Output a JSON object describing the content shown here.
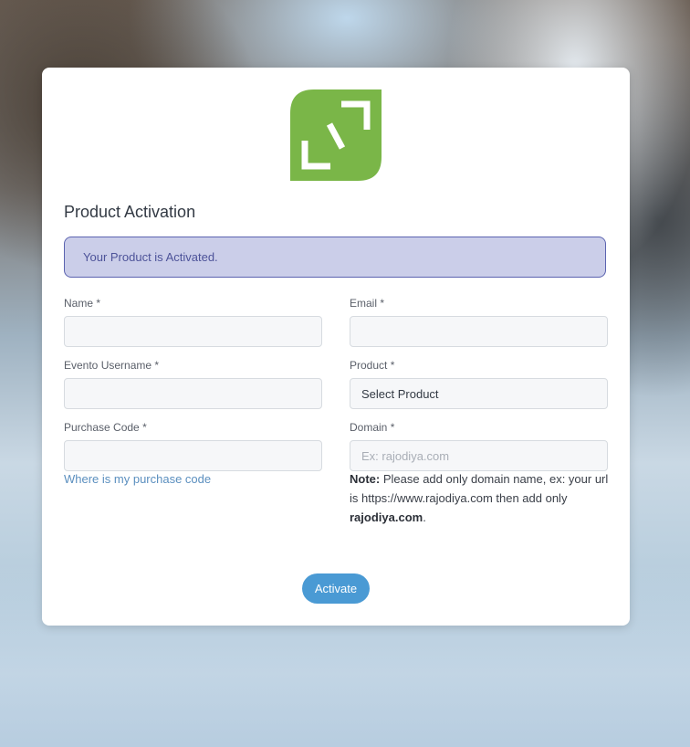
{
  "page": {
    "title": "Product Activation",
    "alert": "Your Product is Activated."
  },
  "form": {
    "name": {
      "label": "Name",
      "required": "*",
      "value": ""
    },
    "email": {
      "label": "Email",
      "required": "*",
      "value": ""
    },
    "username": {
      "label": "Evento Username",
      "required": "*",
      "value": ""
    },
    "product": {
      "label": "Product",
      "required": "*",
      "selected": "Select Product"
    },
    "purchase_code": {
      "label": "Purchase Code",
      "required": "*",
      "value": ""
    },
    "domain": {
      "label": "Domain",
      "required": "*",
      "placeholder": "Ex: rajodiya.com",
      "value": ""
    },
    "purchase_code_link": "Where is my purchase code",
    "note": {
      "prefix": "Note:",
      "text": "Please add only domain name, ex: your url is https://www.rajodiya.com then add only",
      "example": "rajodiya.com",
      "suffix": "."
    },
    "submit_label": "Activate"
  },
  "colors": {
    "logo_green": "#7ab648",
    "alert_bg": "#cbcee9",
    "alert_border": "#5b63b0",
    "button": "#4a9ad4",
    "link": "#5b8fbf"
  },
  "icons": {
    "logo": "leaf-expand-logo"
  }
}
